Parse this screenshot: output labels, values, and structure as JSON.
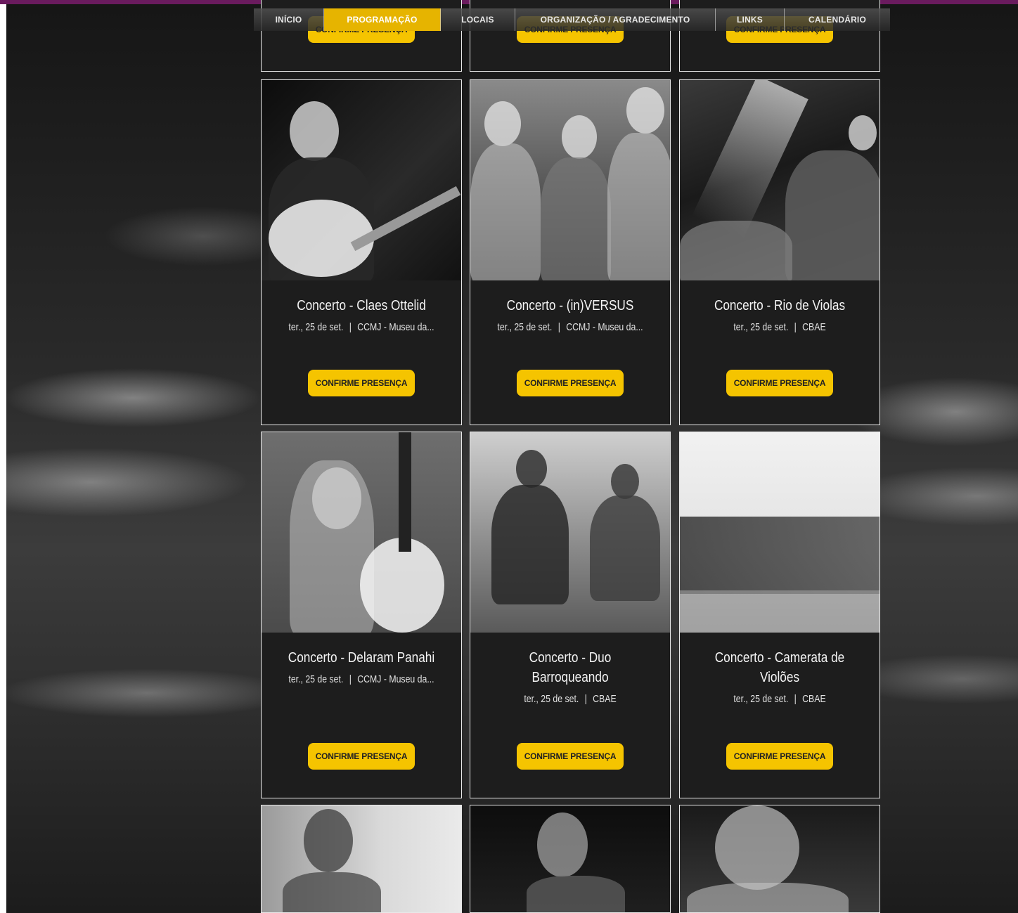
{
  "nav": {
    "items": [
      {
        "label": "INÍCIO",
        "active": false
      },
      {
        "label": "PROGRAMAÇÃO",
        "active": true
      },
      {
        "label": "LOCAIS",
        "active": false
      },
      {
        "label": "ORGANIZAÇÃO / AGRADECIMENTO",
        "active": false
      },
      {
        "label": "LINKS",
        "active": false
      },
      {
        "label": "CALENDÁRIO",
        "active": false
      }
    ]
  },
  "button_label": "CONFIRME PRESENÇA",
  "cards": [
    {
      "title": "Concerto - Claes Ottelid",
      "date": "ter., 25 de set.",
      "venue": "CCMJ - Museu da..."
    },
    {
      "title": "Concerto - (in)VERSUS",
      "date": "ter., 25 de set.",
      "venue": "CCMJ - Museu da..."
    },
    {
      "title": "Concerto - Rio de Violas",
      "date": "ter., 25 de set.",
      "venue": "CBAE"
    },
    {
      "title": "Concerto - Delaram Panahi",
      "date": "ter., 25 de set.",
      "venue": "CCMJ - Museu da..."
    },
    {
      "title": "Concerto - Duo Barroqueando",
      "date": "ter., 25 de set.",
      "venue": "CBAE"
    },
    {
      "title": "Concerto - Camerata de Violões",
      "date": "ter., 25 de set.",
      "venue": "CBAE"
    }
  ],
  "separator": "|",
  "colors": {
    "accent": "#f5c400",
    "nav_active": "#e6b400",
    "card_bg": "#1d1d1d"
  }
}
